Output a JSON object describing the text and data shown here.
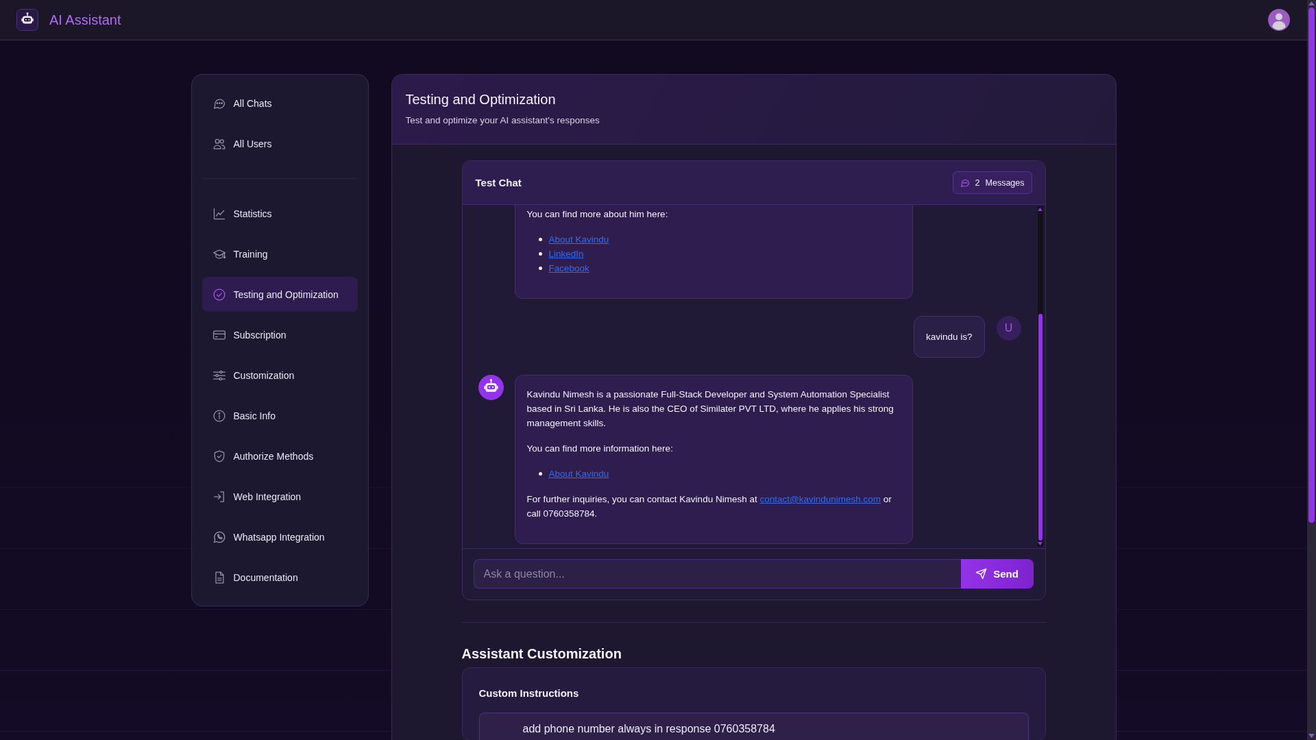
{
  "top_bar": {
    "title": "AI Assistant"
  },
  "sidebar": {
    "sections": [
      {
        "items": [
          {
            "label": "All Chats",
            "selected": false
          },
          {
            "label": "All Users",
            "selected": false
          }
        ]
      },
      {
        "items": [
          {
            "label": "Statistics",
            "selected": false
          },
          {
            "label": "Training",
            "selected": false
          },
          {
            "label": "Testing and Optimization",
            "selected": true
          },
          {
            "label": "Subscription",
            "selected": false
          },
          {
            "label": "Customization",
            "selected": false
          },
          {
            "label": "Basic Info",
            "selected": false
          },
          {
            "label": "Authorize Methods",
            "selected": false
          },
          {
            "label": "Web Integration",
            "selected": false
          },
          {
            "label": "Whatsapp Integration",
            "selected": false
          },
          {
            "label": "Documentation",
            "selected": false
          }
        ]
      }
    ]
  },
  "page_header": {
    "title": "Testing and Optimization",
    "subtitle": "Test and optimize your AI assistant's responses"
  },
  "test_chat": {
    "title": "Test Chat",
    "badge": {
      "count": "2",
      "label": "Messages"
    },
    "messages": [
      {
        "kind": "assistant",
        "clipped_top": true,
        "blocks": [
          {
            "kind": "paragraph",
            "parts": [
              {
                "kind": "text",
                "text": "You can find more about him here:"
              }
            ]
          },
          {
            "kind": "list",
            "items": [
              "About Kavindu",
              "LinkedIn",
              "Facebook"
            ]
          }
        ]
      },
      {
        "kind": "user",
        "clipped_top": false,
        "avatar": "U",
        "blocks": [
          {
            "kind": "paragraph",
            "parts": [
              {
                "kind": "text",
                "text": "kavindu is?"
              }
            ]
          }
        ]
      },
      {
        "kind": "assistant",
        "clipped_top": false,
        "blocks": [
          {
            "kind": "paragraph",
            "parts": [
              {
                "kind": "text",
                "text": "Kavindu Nimesh is a passionate Full-Stack Developer and System Automation Specialist based in Sri Lanka. He is also the CEO of Similater PVT LTD, where he applies his strong management skills."
              }
            ]
          },
          {
            "kind": "paragraph",
            "parts": [
              {
                "kind": "text",
                "text": "You can find more information here:"
              }
            ]
          },
          {
            "kind": "list",
            "items": [
              "About Kavindu"
            ]
          },
          {
            "kind": "paragraph",
            "parts": [
              {
                "kind": "text",
                "text": "For further inquiries, you can contact Kavindu Nimesh at "
              },
              {
                "kind": "link",
                "text": "contact@kavindunimesh.com"
              },
              {
                "kind": "text",
                "text": " or call 0760358784."
              }
            ]
          }
        ]
      }
    ],
    "input": {
      "placeholder": "Ask a question..."
    },
    "send_button": "Send"
  },
  "customization": {
    "title": "Assistant Customization",
    "instructions": {
      "label": "Custom Instructions",
      "value": "add phone number always in response 0760358784"
    }
  }
}
